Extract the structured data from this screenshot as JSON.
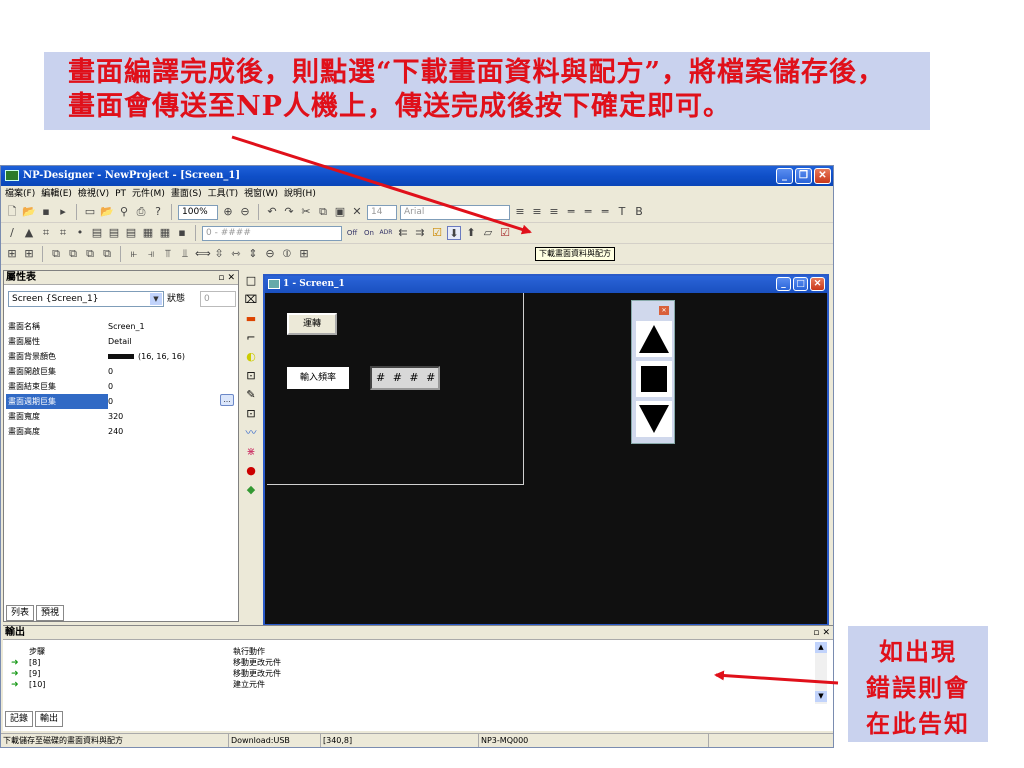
{
  "callouts": {
    "top_line1": "畫面編譯完成後，則點選“下載畫面資料與配方”，將檔案儲存後，",
    "top_line2": "畫面會傳送至NP人機上，傳送完成後按下確定即可。",
    "right_line1": "如出現",
    "right_line2": "錯誤則會",
    "right_line3": "在此告知",
    "text_color": "#e0101a",
    "bg_color": "#c9d2ee"
  },
  "window": {
    "title": "NP-Designer - NewProject - [Screen_1]"
  },
  "menu": [
    "檔案(F)",
    "編輯(E)",
    "檢視(V)",
    "PT",
    "元件(M)",
    "畫面(S)",
    "工具(T)",
    "視窗(W)",
    "說明(H)"
  ],
  "toolbar": {
    "zoom": "100%",
    "font_size": "14",
    "font_name": "Arial",
    "format_field": "0 - ####",
    "tooltip": "下載畫面資料與配方"
  },
  "properties": {
    "title": "屬性表",
    "selected_object": "Screen {Screen_1}",
    "lock_label": "狀態",
    "lock_value": "0",
    "rows": [
      {
        "key": "畫面名稱",
        "value": "Screen_1"
      },
      {
        "key": "畫面屬性",
        "value": "Detail"
      },
      {
        "key": "畫面背景顏色",
        "value": "(16, 16, 16)"
      },
      {
        "key": "畫面開啟巨集",
        "value": "0"
      },
      {
        "key": "畫面結束巨集",
        "value": "0"
      },
      {
        "key": "畫面週期巨集",
        "value": "0"
      },
      {
        "key": "畫面寬度",
        "value": "320"
      },
      {
        "key": "畫面高度",
        "value": "240"
      }
    ],
    "tabs": [
      "列表",
      "預視"
    ]
  },
  "editor": {
    "title": "1 - Screen_1",
    "run_button": "運轉",
    "freq_label": "輸入頻率",
    "numeric_display": "# # # #"
  },
  "output": {
    "title": "輸出",
    "col_step": "步驟",
    "col_action": "執行動作",
    "rows": [
      {
        "step": "[8]",
        "action": "移動更改元件"
      },
      {
        "step": "[9]",
        "action": "移動更改元件"
      },
      {
        "step": "[10]",
        "action": "建立元件"
      }
    ],
    "tabs": [
      "記錄",
      "輸出"
    ]
  },
  "status": {
    "message": "下載儲存至磁碟的畫面資料與配方",
    "download": "Download:USB",
    "coords": "[340,8]",
    "model": "NP3-MQ000"
  }
}
